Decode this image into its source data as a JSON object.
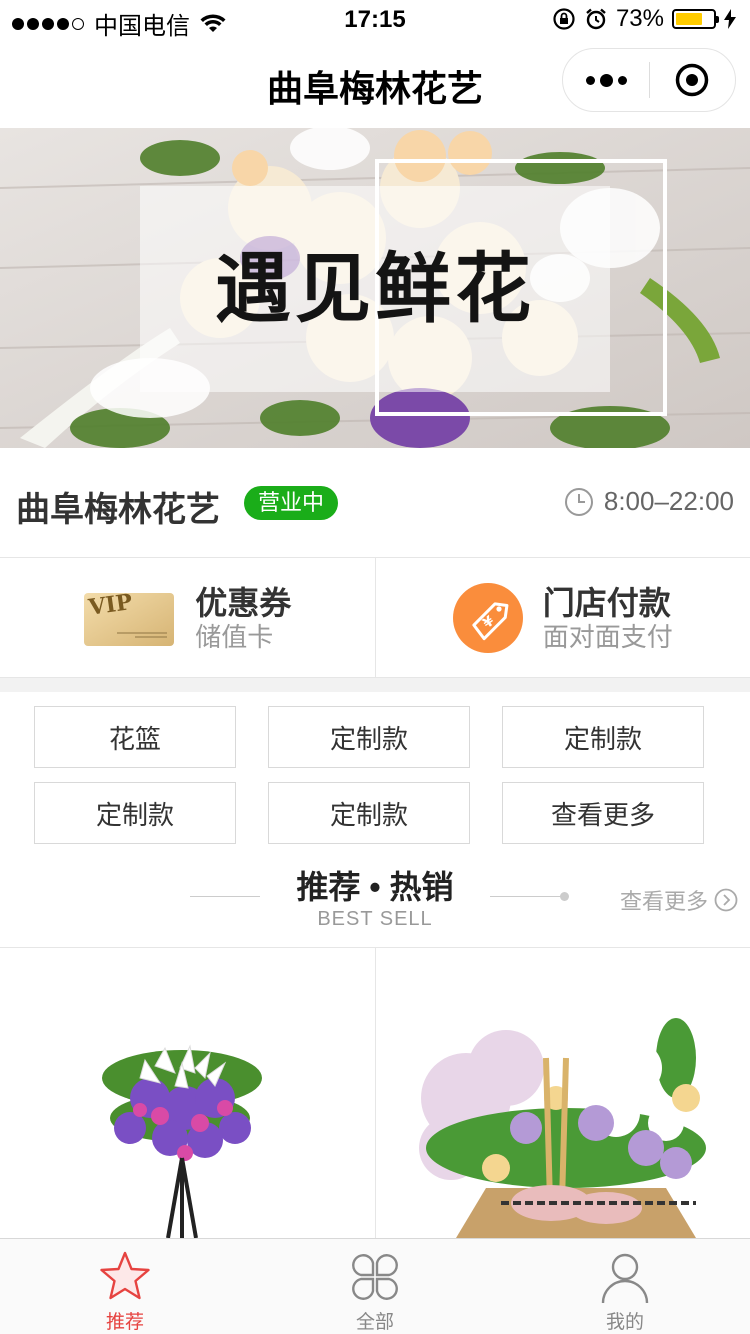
{
  "status_bar": {
    "carrier": "中国电信",
    "time": "17:15",
    "battery": "73%",
    "battery_level": 0.73,
    "battery_color": "#ffcc00"
  },
  "nav": {
    "title": "曲阜梅林花艺"
  },
  "banner": {
    "text": "遇见鲜花"
  },
  "shop": {
    "name": "曲阜梅林花艺",
    "status": "营业中",
    "hours": "8:00–22:00",
    "status_color": "#1aad19"
  },
  "features": [
    {
      "title": "优惠券",
      "subtitle": "储值卡",
      "icon": "vip-card-icon"
    },
    {
      "title": "门店付款",
      "subtitle": "面对面支付",
      "icon": "price-tag-icon"
    }
  ],
  "categories": [
    "花篮",
    "定制款",
    "定制款",
    "定制款",
    "定制款",
    "查看更多"
  ],
  "section": {
    "title": "推荐 • 热销",
    "subtitle": "BEST SELL",
    "more": "查看更多"
  },
  "tabs": [
    {
      "label": "推荐",
      "icon": "star-icon",
      "active": true
    },
    {
      "label": "全部",
      "icon": "grid-icon",
      "active": false
    },
    {
      "label": "我的",
      "icon": "user-icon",
      "active": false
    }
  ],
  "colors": {
    "accent": "#e64340",
    "pay_orange": "#fa8d3c"
  }
}
